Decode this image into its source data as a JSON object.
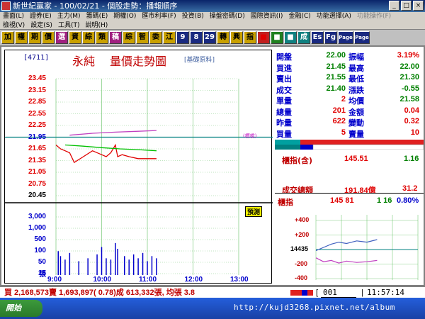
{
  "window": {
    "title": "新世紀贏家 - 100/02/21 - 個股走勢：播報順序",
    "min_label": "_",
    "max_label": "□",
    "close_label": "×"
  },
  "menu": {
    "row1": [
      "畫面(L)",
      "證券(E)",
      "主力(M)",
      "籌碼(E)",
      "期權(O)",
      "匯市利率(F)",
      "投資(B)",
      "操盤密碼(D)",
      "國際資訊(I)",
      "金融(C)",
      "功能選擇(A)"
    ],
    "row1_disabled": "功能操作(F)",
    "row2": [
      "檢視(V)",
      "設定(S)",
      "工具(T)",
      "說明(H)"
    ]
  },
  "toolbar": {
    "buttons": [
      "加",
      "權",
      "期",
      "價",
      "選",
      "資",
      "綜",
      "類",
      "稿",
      "綜",
      "智",
      "委",
      "江",
      "9",
      "8",
      "29",
      "轉",
      "興",
      "指",
      "■",
      "■",
      "■",
      "成",
      "Es",
      "Fg",
      "Page",
      "Page"
    ]
  },
  "stock": {
    "code": "[4711]",
    "name": "永純",
    "chart_title": "量價走勢圖",
    "industry": "[基礎原料]",
    "ref_label": "(標檢)",
    "preview_label": "預測"
  },
  "chart_data": {
    "type": "line",
    "price_ticks": [
      "23.45",
      "23.15",
      "22.85",
      "22.55",
      "22.25",
      "21.95",
      "21.65",
      "21.35",
      "21.05",
      "20.75",
      "20.45"
    ],
    "volume_ticks": [
      "3,000",
      "1,000",
      "500",
      "100",
      "50",
      "15"
    ],
    "volume_unit": "張",
    "time_ticks": [
      "9:00",
      "10:00",
      "11:00",
      "12:00",
      "13:00"
    ],
    "ylim": [
      20.45,
      23.45
    ],
    "reference_price": 21.95,
    "series": [
      {
        "values": [
          [
            0,
            21.75
          ],
          [
            0.1,
            21.65
          ],
          [
            0.2,
            21.6
          ],
          [
            0.3,
            21.55
          ],
          [
            0.4,
            21.3
          ],
          [
            0.6,
            21.45
          ],
          [
            0.8,
            21.6
          ],
          [
            1.0,
            21.5
          ],
          [
            1.1,
            21.45
          ],
          [
            1.2,
            21.55
          ],
          [
            1.3,
            21.75
          ],
          [
            1.35,
            21.45
          ],
          [
            1.45,
            21.5
          ],
          [
            1.6,
            21.45
          ],
          [
            1.8,
            21.4
          ],
          [
            2.0,
            21.4
          ],
          [
            2.2,
            21.4
          ]
        ]
      },
      {
        "values": [
          [
            0.2,
            21.75
          ],
          [
            0.6,
            21.72
          ],
          [
            1.0,
            21.68
          ],
          [
            1.4,
            21.65
          ],
          [
            1.8,
            21.63
          ],
          [
            2.2,
            21.6
          ]
        ]
      },
      {
        "values": [
          [
            0.3,
            22.0
          ],
          [
            0.8,
            22.05
          ],
          [
            1.3,
            22.08
          ],
          [
            1.8,
            22.1
          ],
          [
            2.2,
            22.12
          ]
        ]
      }
    ],
    "volumes": [
      [
        0.05,
        15
      ],
      [
        0.1,
        8
      ],
      [
        0.2,
        5
      ],
      [
        0.3,
        12
      ],
      [
        0.5,
        4
      ],
      [
        0.7,
        6
      ],
      [
        0.9,
        10
      ],
      [
        1.0,
        25
      ],
      [
        1.1,
        6
      ],
      [
        1.2,
        5
      ],
      [
        1.3,
        40
      ],
      [
        1.35,
        20
      ],
      [
        1.5,
        8
      ],
      [
        1.6,
        5
      ],
      [
        1.7,
        10
      ],
      [
        1.8,
        6
      ],
      [
        1.9,
        12
      ],
      [
        2.0,
        4
      ],
      [
        2.1,
        8
      ],
      [
        2.2,
        6
      ]
    ]
  },
  "quote": {
    "rows": [
      {
        "l1": "開盤",
        "v1": "22.00",
        "c1": "green",
        "l2": "振幅",
        "v2": "3.19%",
        "c2": "red"
      },
      {
        "l1": "買進",
        "v1": "21.45",
        "c1": "green",
        "l2": "最高",
        "v2": "22.00",
        "c2": "green"
      },
      {
        "l1": "賣出",
        "v1": "21.55",
        "c1": "green",
        "l2": "最低",
        "v2": "21.30",
        "c2": "green"
      },
      {
        "l1": "成交",
        "v1": "21.40",
        "c1": "green",
        "l2": "漲跌",
        "v2": "-0.55",
        "c2": "green"
      },
      {
        "l1": "單量",
        "v1": "2",
        "c1": "red",
        "l2": "均價",
        "v2": "21.58",
        "c2": "green"
      },
      {
        "l1": "總量",
        "v1": "201",
        "c1": "red",
        "l2": "金額",
        "v2": "0.04",
        "c2": "red"
      },
      {
        "l1": "昨量",
        "v1": "622",
        "c1": "red",
        "l2": "變動",
        "v2": "0.32",
        "c2": "red"
      },
      {
        "l1": "買量",
        "v1": "5",
        "c1": "red",
        "l2": "賣量",
        "v2": "10",
        "c2": "red"
      }
    ],
    "index_label": "櫃指(含)",
    "index_value": "145.51",
    "index_change": "1.16",
    "turnover_label": "成交總額",
    "turnover_value": "191.84億",
    "turnover_change": "31.2"
  },
  "mini": {
    "label": "櫃指",
    "value": "145 81",
    "change": "1 16",
    "pct": "0.80%",
    "ticks": [
      "+400",
      "+200",
      "14435",
      "-200",
      "-400"
    ]
  },
  "status": {
    "text": "買 2,168,573賣 1,693,897( 0.78)成 613,332張, 均張 3.8",
    "input_value": "001",
    "time": "11:57:14"
  },
  "taskbar": {
    "start_label": "開始",
    "watermark": "http://kujd3268.pixnet.net/album"
  },
  "colors": {
    "price_line": "#e00000",
    "avg_line": "#00c000",
    "index_line": "#c040c0",
    "vol_bar": "#0000cc",
    "ref_line": "#008080"
  }
}
